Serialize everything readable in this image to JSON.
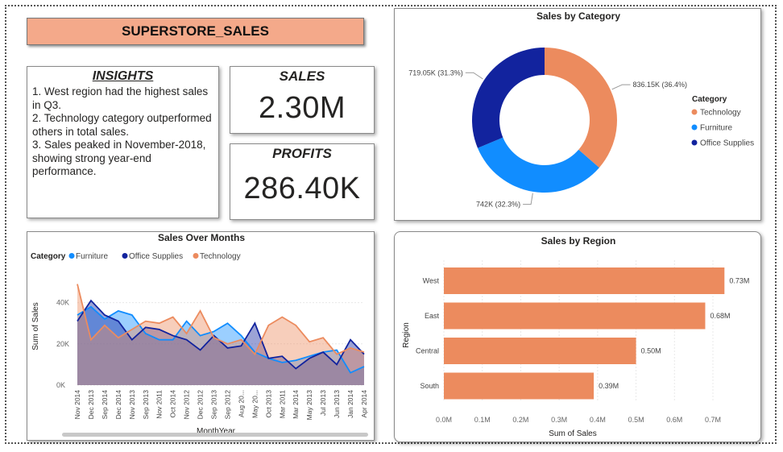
{
  "title": "SUPERSTORE_SALES",
  "insights": {
    "heading": "INSIGHTS",
    "lines": [
      "1. West region had the highest sales in Q3.",
      "2. Technology category outperformed others in total sales.",
      "3. Sales peaked in November-2018, showing strong year-end performance."
    ]
  },
  "kpis": {
    "sales_label": "SALES",
    "sales_value": "2.30M",
    "profits_label": "PROFITS",
    "profits_value": "286.40K"
  },
  "colors": {
    "technology": "#ec8b5e",
    "furniture": "#118dff",
    "office_supplies": "#12239e",
    "bar": "#ec8b5e"
  },
  "chart_data": [
    {
      "type": "pie",
      "title": "Sales by Category",
      "legend_title": "Category",
      "legend_position": "right",
      "categories": [
        "Technology",
        "Furniture",
        "Office Supplies"
      ],
      "values": [
        836.15,
        742,
        719.05
      ],
      "labels": [
        "836.15K (36.4%)",
        "742K (32.3%)",
        "719.05K (31.3%)"
      ],
      "colors": [
        "#ec8b5e",
        "#118dff",
        "#12239e"
      ]
    },
    {
      "type": "area",
      "title": "Sales Over Months",
      "xlabel": "MonthYear",
      "ylabel": "Sum of Sales",
      "legend_title": "Category",
      "legend_position": "top-left",
      "yticks": [
        "0K",
        "20K",
        "40K"
      ],
      "ylim": [
        0,
        50
      ],
      "x": [
        "Nov 2014",
        "Dec 2013",
        "Sep 2014",
        "Dec 2014",
        "Nov 2013",
        "Sep 2013",
        "Nov 2011",
        "Oct 2014",
        "Nov 2012",
        "Dec 2012",
        "Sep 2013",
        "Sep 2012",
        "Aug 2012",
        "May 2012",
        "Oct 2013",
        "Mar 2011",
        "Mar 2014",
        "May 2013",
        "Jul 2013",
        "Jun 2013",
        "Jan 2014",
        "Apr 2014"
      ],
      "x_tick_labels": [
        "Nov 2014",
        "Dec 2013",
        "Sep 2014",
        "Dec 2014",
        "Nov 2013",
        "Sep 2013",
        "Nov 2011",
        "Oct 2014",
        "Nov 2012",
        "Dec 2012",
        "Sep 2013",
        "Sep 2012",
        "Aug 20...",
        "May 20...",
        "Oct 2013",
        "Mar 2011",
        "Mar 2014",
        "May 2013",
        "Jul 2013",
        "Jun 2013",
        "Jan 2014",
        "Apr 2014"
      ],
      "series": [
        {
          "name": "Furniture",
          "color": "#118dff",
          "values": [
            34,
            38,
            32,
            36,
            34,
            25,
            22,
            22,
            31,
            24,
            26,
            30,
            24,
            16,
            13,
            11,
            12,
            14,
            16,
            17,
            6,
            9
          ]
        },
        {
          "name": "Office Supplies",
          "color": "#12239e",
          "values": [
            31,
            41,
            34,
            31,
            22,
            28,
            27,
            24,
            22,
            17,
            24,
            18,
            19,
            30,
            13,
            14,
            8,
            13,
            16,
            10,
            22,
            15
          ]
        },
        {
          "name": "Technology",
          "color": "#ec8b5e",
          "values": [
            49,
            22,
            29,
            23,
            27,
            31,
            30,
            33,
            25,
            36,
            23,
            20,
            22,
            15,
            29,
            33,
            29,
            21,
            23,
            15,
            18,
            16
          ]
        }
      ]
    },
    {
      "type": "bar",
      "orientation": "horizontal",
      "title": "Sales by Region",
      "xlabel": "Sum of Sales",
      "ylabel": "Region",
      "categories": [
        "West",
        "East",
        "Central",
        "South"
      ],
      "values": [
        0.73,
        0.68,
        0.5,
        0.39
      ],
      "labels": [
        "0.73M",
        "0.68M",
        "0.50M",
        "0.39M"
      ],
      "xticks": [
        "0.0M",
        "0.1M",
        "0.2M",
        "0.3M",
        "0.4M",
        "0.5M",
        "0.6M",
        "0.7M"
      ],
      "xlim": [
        0,
        0.7
      ]
    }
  ]
}
